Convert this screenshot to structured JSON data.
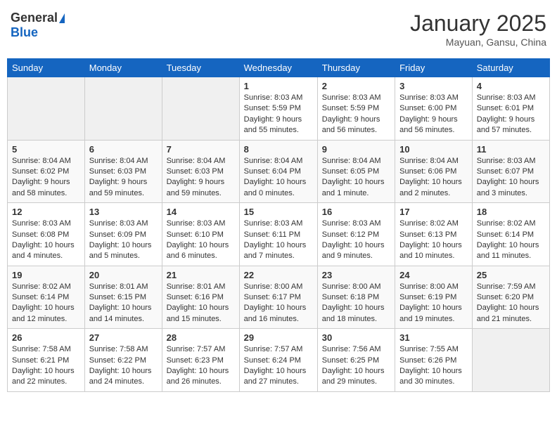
{
  "header": {
    "logo_general": "General",
    "logo_blue": "Blue",
    "month_year": "January 2025",
    "location": "Mayuan, Gansu, China"
  },
  "days_of_week": [
    "Sunday",
    "Monday",
    "Tuesday",
    "Wednesday",
    "Thursday",
    "Friday",
    "Saturday"
  ],
  "weeks": [
    [
      {
        "day": "",
        "info": ""
      },
      {
        "day": "",
        "info": ""
      },
      {
        "day": "",
        "info": ""
      },
      {
        "day": "1",
        "info": "Sunrise: 8:03 AM\nSunset: 5:59 PM\nDaylight: 9 hours\nand 55 minutes."
      },
      {
        "day": "2",
        "info": "Sunrise: 8:03 AM\nSunset: 5:59 PM\nDaylight: 9 hours\nand 56 minutes."
      },
      {
        "day": "3",
        "info": "Sunrise: 8:03 AM\nSunset: 6:00 PM\nDaylight: 9 hours\nand 56 minutes."
      },
      {
        "day": "4",
        "info": "Sunrise: 8:03 AM\nSunset: 6:01 PM\nDaylight: 9 hours\nand 57 minutes."
      }
    ],
    [
      {
        "day": "5",
        "info": "Sunrise: 8:04 AM\nSunset: 6:02 PM\nDaylight: 9 hours\nand 58 minutes."
      },
      {
        "day": "6",
        "info": "Sunrise: 8:04 AM\nSunset: 6:03 PM\nDaylight: 9 hours\nand 59 minutes."
      },
      {
        "day": "7",
        "info": "Sunrise: 8:04 AM\nSunset: 6:03 PM\nDaylight: 9 hours\nand 59 minutes."
      },
      {
        "day": "8",
        "info": "Sunrise: 8:04 AM\nSunset: 6:04 PM\nDaylight: 10 hours\nand 0 minutes."
      },
      {
        "day": "9",
        "info": "Sunrise: 8:04 AM\nSunset: 6:05 PM\nDaylight: 10 hours\nand 1 minute."
      },
      {
        "day": "10",
        "info": "Sunrise: 8:04 AM\nSunset: 6:06 PM\nDaylight: 10 hours\nand 2 minutes."
      },
      {
        "day": "11",
        "info": "Sunrise: 8:03 AM\nSunset: 6:07 PM\nDaylight: 10 hours\nand 3 minutes."
      }
    ],
    [
      {
        "day": "12",
        "info": "Sunrise: 8:03 AM\nSunset: 6:08 PM\nDaylight: 10 hours\nand 4 minutes."
      },
      {
        "day": "13",
        "info": "Sunrise: 8:03 AM\nSunset: 6:09 PM\nDaylight: 10 hours\nand 5 minutes."
      },
      {
        "day": "14",
        "info": "Sunrise: 8:03 AM\nSunset: 6:10 PM\nDaylight: 10 hours\nand 6 minutes."
      },
      {
        "day": "15",
        "info": "Sunrise: 8:03 AM\nSunset: 6:11 PM\nDaylight: 10 hours\nand 7 minutes."
      },
      {
        "day": "16",
        "info": "Sunrise: 8:03 AM\nSunset: 6:12 PM\nDaylight: 10 hours\nand 9 minutes."
      },
      {
        "day": "17",
        "info": "Sunrise: 8:02 AM\nSunset: 6:13 PM\nDaylight: 10 hours\nand 10 minutes."
      },
      {
        "day": "18",
        "info": "Sunrise: 8:02 AM\nSunset: 6:14 PM\nDaylight: 10 hours\nand 11 minutes."
      }
    ],
    [
      {
        "day": "19",
        "info": "Sunrise: 8:02 AM\nSunset: 6:14 PM\nDaylight: 10 hours\nand 12 minutes."
      },
      {
        "day": "20",
        "info": "Sunrise: 8:01 AM\nSunset: 6:15 PM\nDaylight: 10 hours\nand 14 minutes."
      },
      {
        "day": "21",
        "info": "Sunrise: 8:01 AM\nSunset: 6:16 PM\nDaylight: 10 hours\nand 15 minutes."
      },
      {
        "day": "22",
        "info": "Sunrise: 8:00 AM\nSunset: 6:17 PM\nDaylight: 10 hours\nand 16 minutes."
      },
      {
        "day": "23",
        "info": "Sunrise: 8:00 AM\nSunset: 6:18 PM\nDaylight: 10 hours\nand 18 minutes."
      },
      {
        "day": "24",
        "info": "Sunrise: 8:00 AM\nSunset: 6:19 PM\nDaylight: 10 hours\nand 19 minutes."
      },
      {
        "day": "25",
        "info": "Sunrise: 7:59 AM\nSunset: 6:20 PM\nDaylight: 10 hours\nand 21 minutes."
      }
    ],
    [
      {
        "day": "26",
        "info": "Sunrise: 7:58 AM\nSunset: 6:21 PM\nDaylight: 10 hours\nand 22 minutes."
      },
      {
        "day": "27",
        "info": "Sunrise: 7:58 AM\nSunset: 6:22 PM\nDaylight: 10 hours\nand 24 minutes."
      },
      {
        "day": "28",
        "info": "Sunrise: 7:57 AM\nSunset: 6:23 PM\nDaylight: 10 hours\nand 26 minutes."
      },
      {
        "day": "29",
        "info": "Sunrise: 7:57 AM\nSunset: 6:24 PM\nDaylight: 10 hours\nand 27 minutes."
      },
      {
        "day": "30",
        "info": "Sunrise: 7:56 AM\nSunset: 6:25 PM\nDaylight: 10 hours\nand 29 minutes."
      },
      {
        "day": "31",
        "info": "Sunrise: 7:55 AM\nSunset: 6:26 PM\nDaylight: 10 hours\nand 30 minutes."
      },
      {
        "day": "",
        "info": ""
      }
    ]
  ]
}
